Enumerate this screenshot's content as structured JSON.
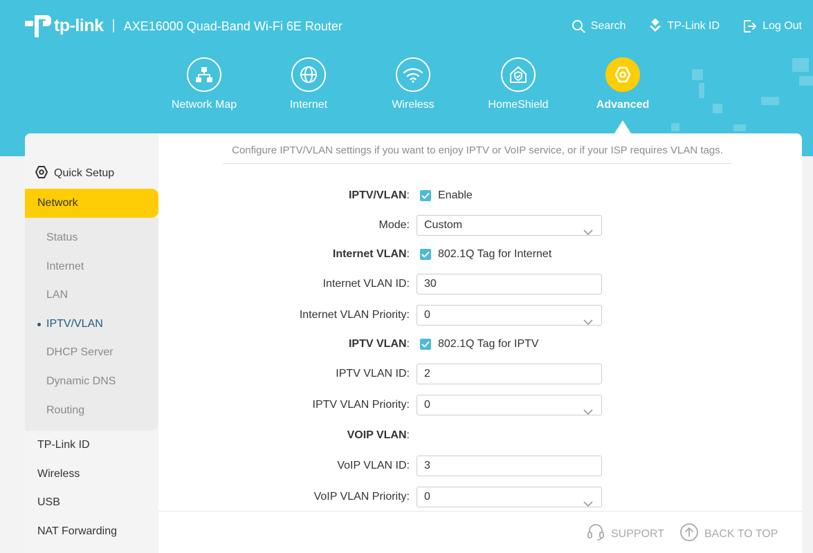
{
  "header": {
    "brand": "tp-link",
    "separator": "|",
    "product_title": "AXE16000 Quad-Band Wi-Fi 6E Router",
    "links": {
      "search": "Search",
      "tplink_id": "TP-Link ID",
      "logout": "Log Out"
    }
  },
  "nav": {
    "items": [
      {
        "label": "Network Map",
        "icon": "network-map-icon"
      },
      {
        "label": "Internet",
        "icon": "globe-icon"
      },
      {
        "label": "Wireless",
        "icon": "wifi-icon"
      },
      {
        "label": "HomeShield",
        "icon": "home-shield-icon"
      },
      {
        "label": "Advanced",
        "icon": "gear-icon",
        "active": true
      }
    ]
  },
  "sidebar": {
    "quick_setup": "Quick Setup",
    "network": "Network",
    "network_sub": [
      "Status",
      "Internet",
      "LAN",
      "IPTV/VLAN",
      "DHCP Server",
      "Dynamic DNS",
      "Routing"
    ],
    "current_sub": "IPTV/VLAN",
    "items": [
      "TP-Link ID",
      "Wireless",
      "USB",
      "NAT Forwarding"
    ]
  },
  "content": {
    "description": "Configure IPTV/VLAN settings if you want to enjoy IPTV or VoIP service, or if your ISP requires VLAN tags.",
    "iptv_vlan": {
      "label": "IPTV/VLAN",
      "checkbox": "Enable",
      "checked": true
    },
    "mode": {
      "label": "Mode:",
      "value": "Custom"
    },
    "internet_vlan": {
      "label": "Internet VLAN",
      "checkbox": "802.1Q Tag for Internet",
      "checked": true
    },
    "internet_vlan_id": {
      "label": "Internet VLAN ID:",
      "value": "30"
    },
    "internet_vlan_priority": {
      "label": "Internet VLAN Priority:",
      "value": "0"
    },
    "iptv_vlan_tag": {
      "label": "IPTV VLAN",
      "checkbox": "802.1Q Tag for IPTV",
      "checked": true
    },
    "iptv_vlan_id": {
      "label": "IPTV VLAN ID:",
      "value": "2"
    },
    "iptv_vlan_priority": {
      "label": "IPTV VLAN Priority:",
      "value": "0"
    },
    "voip_vlan": {
      "label": "VOIP VLAN"
    },
    "voip_vlan_id": {
      "label": "VoIP VLAN ID:",
      "value": "3"
    },
    "voip_vlan_priority": {
      "label": "VoIP VLAN Priority:",
      "value": "0"
    },
    "colon": ":"
  },
  "footer": {
    "support": "SUPPORT",
    "back_to_top": "BACK TO TOP"
  },
  "colors": {
    "header_bg": "#45c2dd",
    "accent_yellow": "#ffcd05",
    "checkbox": "#4bbbd5"
  }
}
